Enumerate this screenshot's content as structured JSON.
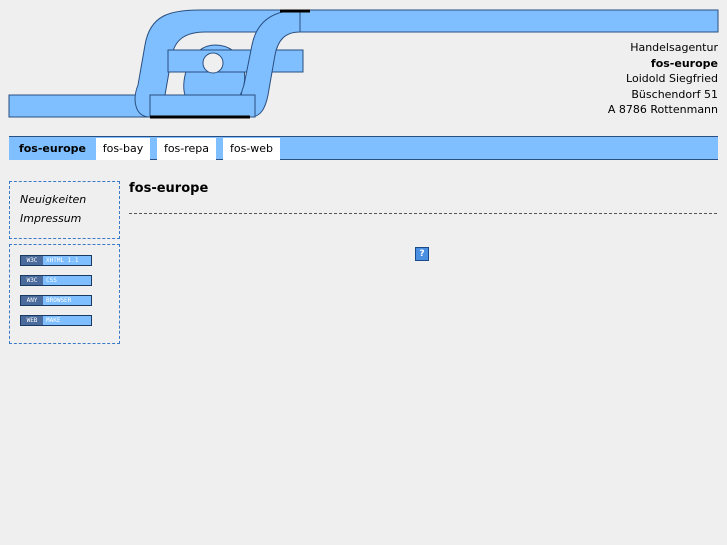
{
  "header": {
    "address_lines": [
      {
        "text": "Handelsagentur",
        "bold": false
      },
      {
        "text": "fos-europe",
        "bold": true
      },
      {
        "text": "Loidold Siegfried",
        "bold": false
      },
      {
        "text": "Büschendorf 51",
        "bold": false
      },
      {
        "text": "A 8786 Rottenmann",
        "bold": false
      }
    ]
  },
  "nav": {
    "tabs": [
      {
        "label": "fos-europe",
        "active": true
      },
      {
        "label": "fos-bay",
        "active": false
      },
      {
        "label": "fos-repa",
        "active": false
      },
      {
        "label": "fos-web",
        "active": false
      }
    ]
  },
  "sidebar": {
    "links": [
      "Neuigkeiten",
      "Impressum"
    ],
    "badges": [
      {
        "left": "W3C",
        "right": "XHTML 1.1"
      },
      {
        "left": "W3C",
        "right": "CSS"
      },
      {
        "left": "ANY",
        "right": "BROWSER"
      },
      {
        "left": "WEB",
        "right": "MAKE"
      }
    ]
  },
  "main": {
    "title": "fos-europe",
    "help_icon_glyph": "?"
  },
  "colors": {
    "accent": "#7fbfff",
    "background": "#efefef",
    "border": "#3a78c8"
  }
}
